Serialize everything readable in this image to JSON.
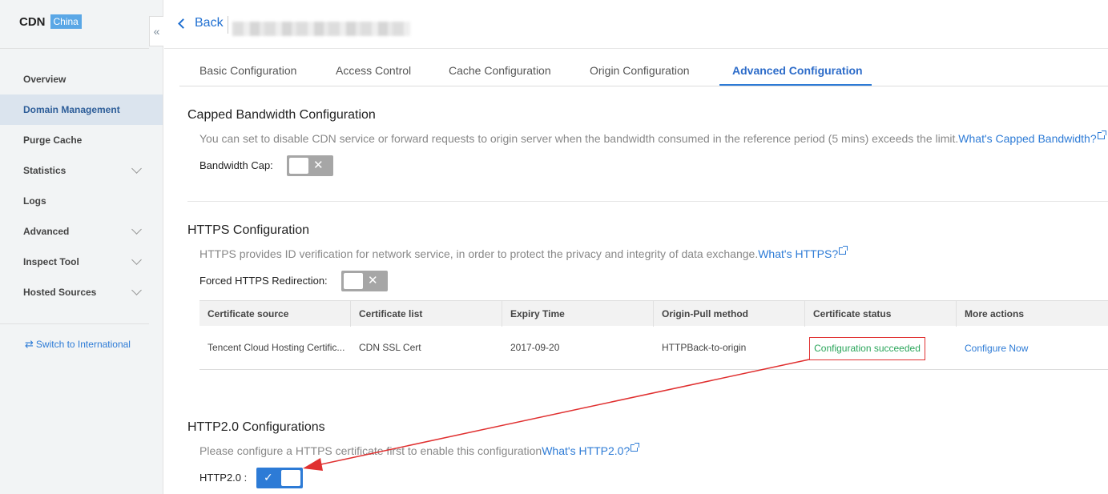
{
  "brand": {
    "name": "CDN",
    "badge": "China"
  },
  "sidebar": {
    "items": [
      {
        "label": "Overview"
      },
      {
        "label": "Domain Management"
      },
      {
        "label": "Purge Cache"
      },
      {
        "label": "Statistics"
      },
      {
        "label": "Logs"
      },
      {
        "label": "Advanced"
      },
      {
        "label": "Inspect Tool"
      },
      {
        "label": "Hosted Sources"
      }
    ],
    "switch_label": "Switch to International"
  },
  "header": {
    "back_label": "Back"
  },
  "tabs": [
    {
      "label": "Basic Configuration"
    },
    {
      "label": "Access Control"
    },
    {
      "label": "Cache Configuration"
    },
    {
      "label": "Origin Configuration"
    },
    {
      "label": "Advanced Configuration"
    }
  ],
  "capped": {
    "title": "Capped Bandwidth Configuration",
    "desc": "You can set to disable CDN service or forward requests to origin server when the bandwidth consumed in the reference period (5 mins) exceeds the limit.",
    "link": "What's Capped Bandwidth?",
    "field_label": "Bandwidth Cap:",
    "toggle_mark": "✕"
  },
  "https": {
    "title": "HTTPS Configuration",
    "desc": "HTTPS provides ID verification for network service, in order to protect the privacy and integrity of data exchange.",
    "link": "What's HTTPS?",
    "field_label": "Forced HTTPS Redirection:",
    "toggle_mark": "✕",
    "table": {
      "headers": [
        "Certificate source",
        "Certificate list",
        "Expiry Time",
        "Origin-Pull method",
        "Certificate status",
        "More actions"
      ],
      "row": [
        "Tencent Cloud Hosting Certific...",
        "CDN SSL Cert",
        "2017-09-20",
        "HTTPBack-to-origin",
        "Configuration succeeded",
        "Configure Now"
      ]
    }
  },
  "http2": {
    "title": "HTTP2.0 Configurations",
    "desc": "Please configure a HTTPS certificate first to enable this configuration",
    "link": "What's HTTP2.0?",
    "field_label": "HTTP2.0 :",
    "toggle_mark": "✓",
    "enabled": true
  },
  "colors": {
    "accent": "#2d7bd6",
    "success": "#2aa55a",
    "annotation": "#e03030"
  }
}
